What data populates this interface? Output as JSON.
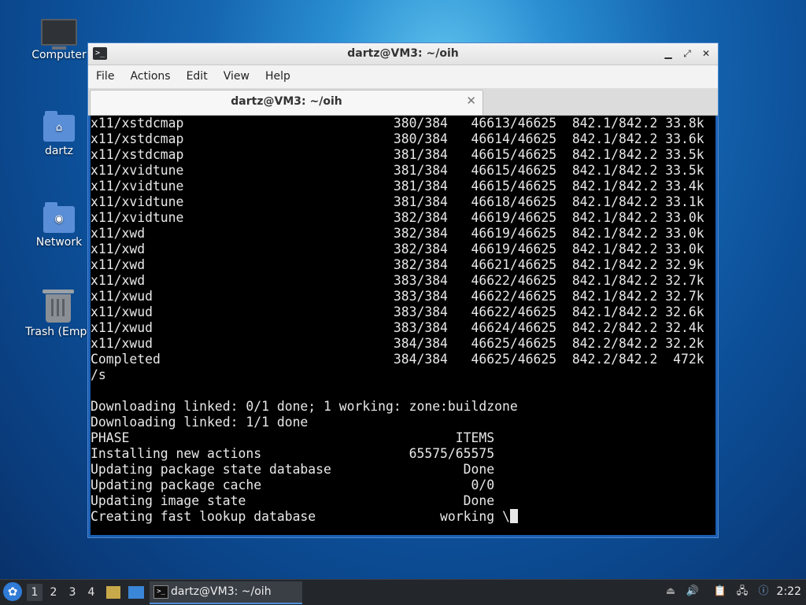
{
  "desktop": {
    "icons": [
      {
        "label": "Computer",
        "icon": "computer-icon"
      },
      {
        "label": "dartz",
        "icon": "home-folder-icon"
      },
      {
        "label": "Network",
        "icon": "network-folder-icon"
      },
      {
        "label": "Trash (Empt",
        "icon": "trash-icon"
      }
    ]
  },
  "window": {
    "title": "dartz@VM3: ~/oih",
    "menu": [
      "File",
      "Edit",
      "View",
      "Help"
    ],
    "menu_actions": "Actions",
    "tab_label": "dartz@VM3: ~/oih",
    "terminal_text": "x11/xstdcmap                           380/384   46613/46625  842.1/842.2 33.8k\nx11/xstdcmap                           380/384   46614/46625  842.1/842.2 33.6k\nx11/xstdcmap                           381/384   46615/46625  842.1/842.2 33.5k\nx11/xvidtune                           381/384   46615/46625  842.1/842.2 33.5k\nx11/xvidtune                           381/384   46615/46625  842.1/842.2 33.4k\nx11/xvidtune                           381/384   46618/46625  842.1/842.2 33.1k\nx11/xvidtune                           382/384   46619/46625  842.1/842.2 33.0k\nx11/xwd                                382/384   46619/46625  842.1/842.2 33.0k\nx11/xwd                                382/384   46619/46625  842.1/842.2 33.0k\nx11/xwd                                382/384   46621/46625  842.1/842.2 32.9k\nx11/xwd                                383/384   46622/46625  842.1/842.2 32.7k\nx11/xwud                               383/384   46622/46625  842.1/842.2 32.7k\nx11/xwud                               383/384   46622/46625  842.1/842.2 32.6k\nx11/xwud                               383/384   46624/46625  842.2/842.2 32.4k\nx11/xwud                               384/384   46625/46625  842.2/842.2 32.2k\nCompleted                              384/384   46625/46625  842.2/842.2  472k\n/s\n\nDownloading linked: 0/1 done; 1 working: zone:buildzone\nDownloading linked: 1/1 done\nPHASE                                          ITEMS\nInstalling new actions                   65575/65575\nUpdating package state database                 Done\nUpdating package cache                           0/0\nUpdating image state                            Done\nCreating fast lookup database                working \\"
  },
  "taskbar": {
    "workspaces": [
      "1",
      "2",
      "3",
      "4"
    ],
    "task_label": "dartz@VM3: ~/oih",
    "clock": "2:22"
  }
}
